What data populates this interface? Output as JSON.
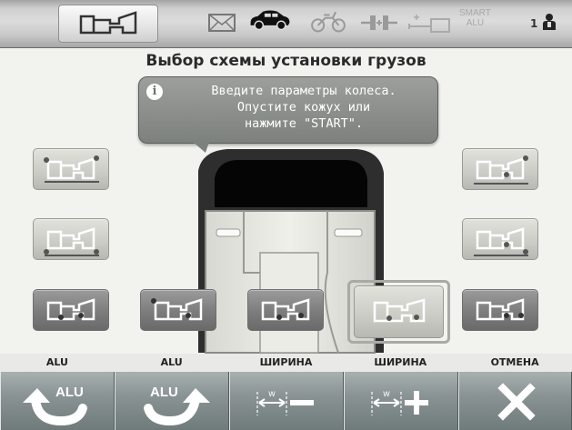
{
  "header": {
    "logo_icon": "wheel-profile-icon",
    "icons": [
      "envelope-icon",
      "car-icon",
      "motorcycle-icon",
      "weight-plus-icon",
      "weight-minus-icon"
    ],
    "smart_line1": "SMART",
    "smart_line2": "ALU",
    "user_number": "1"
  },
  "title": "Выбор схемы установки грузов",
  "message": {
    "line1": "Введите параметры колеса.",
    "line2": "Опустите кожух или",
    "line3": "нажмите \"START\"."
  },
  "profiles": [
    {
      "id": "left-1",
      "state": "light"
    },
    {
      "id": "left-2",
      "state": "light"
    },
    {
      "id": "right-1",
      "state": "light"
    },
    {
      "id": "right-2",
      "state": "light"
    },
    {
      "id": "bottom-1",
      "state": "dark"
    },
    {
      "id": "bottom-2",
      "state": "dark"
    },
    {
      "id": "bottom-3",
      "state": "dark"
    },
    {
      "id": "bottom-4",
      "state": "selected"
    },
    {
      "id": "bottom-5",
      "state": "dark"
    }
  ],
  "footer": {
    "labels": [
      "ALU",
      "ALU",
      "ШИРИНА",
      "ШИРИНА",
      "ОТМЕНА"
    ],
    "alu_prev_text": "ALU",
    "alu_next_text": "ALU",
    "width_minus_label": "w",
    "width_plus_label": "w",
    "icons": [
      "alu-previous-icon",
      "alu-next-icon",
      "width-minus-icon",
      "width-plus-icon",
      "close-icon"
    ]
  },
  "colors": {
    "button_dark": "#7c7c7c",
    "button_light": "#cbcbc5",
    "footer_button": "#8a9494",
    "message_bg": "#8a8e8a"
  }
}
